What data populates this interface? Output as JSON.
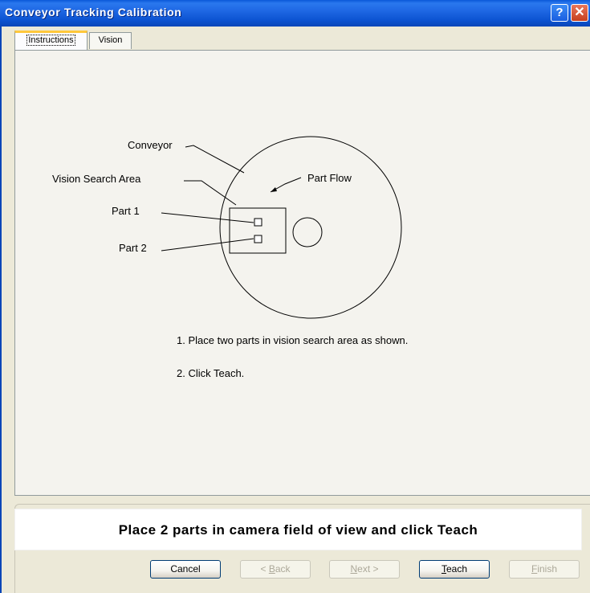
{
  "window": {
    "title": "Conveyor Tracking Calibration",
    "help_label": "?",
    "close_label": "✕"
  },
  "tabs": [
    {
      "label": "Instructions",
      "active": true
    },
    {
      "label": "Vision",
      "active": false
    }
  ],
  "diagram": {
    "labels": {
      "conveyor": "Conveyor",
      "vision_search_area": "Vision Search Area",
      "part1": "Part 1",
      "part2": "Part 2",
      "part_flow": "Part Flow"
    }
  },
  "instructions": [
    "1. Place two parts in vision search area as shown.",
    "2. Click Teach."
  ],
  "status_message": "Place 2 parts in camera field of view and click Teach",
  "buttons": {
    "cancel": {
      "label": "Cancel",
      "enabled": true
    },
    "back": {
      "prefix": "< ",
      "mnemonic": "B",
      "rest": "ack",
      "enabled": false
    },
    "next": {
      "mnemonic": "N",
      "rest": "ext >",
      "enabled": false
    },
    "teach": {
      "mnemonic": "T",
      "rest": "each",
      "enabled": true
    },
    "finish": {
      "mnemonic": "F",
      "rest": "inish",
      "enabled": false
    }
  }
}
